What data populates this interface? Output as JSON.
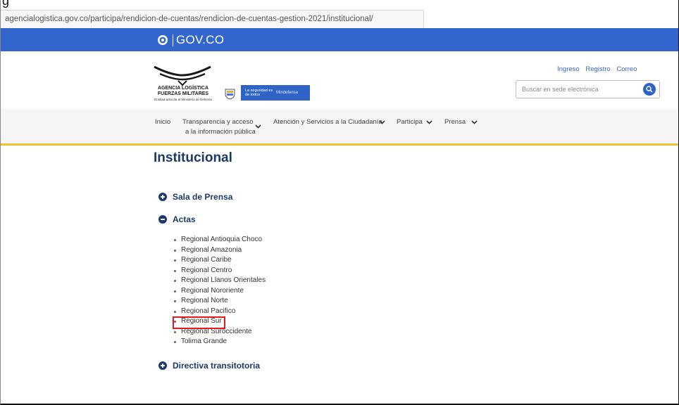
{
  "top_fragment": "g",
  "browser": {
    "url": "agencialogistica.gov.co/participa/rendicion-de-cuentas/rendicion-de-cuentas-gestion-2021/institucional/"
  },
  "gov_bar": {
    "brand_text": "GOV.CO",
    "color": "#3366cc"
  },
  "header": {
    "agency_name": "AGENCIA LOGÍSTICA FUERZAS MILITARES",
    "agency_subtitle": "Entidad adscrita al Ministerio de Defensa",
    "mindefensa_slogan": "La seguridad es de todos",
    "mindefensa_name": "Mindefensa",
    "links": {
      "login": "Ingreso",
      "register": "Registro",
      "mail": "Correo"
    },
    "search": {
      "placeholder": "Buscar en sede electrónica",
      "value": ""
    }
  },
  "nav": {
    "inicio": "Inicio",
    "transparencia_line1": "Transparencia y acceso",
    "transparencia_line2": "a la información pública",
    "atencion": "Atención y Servicios a la Ciudadanía",
    "participa": "Participa",
    "prensa": "Prensa"
  },
  "main": {
    "title": "Institucional",
    "sections": [
      {
        "label": "Sala de Prensa",
        "state": "collapsed"
      },
      {
        "label": "Actas",
        "state": "expanded"
      },
      {
        "label": "Directiva transitotoria",
        "state": "collapsed"
      }
    ],
    "actas_items": [
      "Regional Antioquia Choco",
      "Regional Amazonia",
      "Regional Caribe",
      "Regional Centro",
      "Regional Llanos Orientales",
      "Regional Nororiente",
      "Regional Norte",
      "Regional Pacifico",
      "Regional Sur",
      "Regional Suroccidente",
      "Tolima Grande"
    ],
    "highlighted_item": "Regional Sur",
    "highlight_color": "#e11b22"
  },
  "colors": {
    "accent": "#f2c12e",
    "title": "#1b3a6b"
  }
}
